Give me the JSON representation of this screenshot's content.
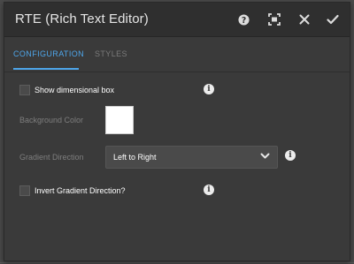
{
  "dialog": {
    "title": "RTE (Rich Text Editor)",
    "toolbar": {
      "help_icon": "help-icon",
      "fullscreen_icon": "fullscreen-icon",
      "close_icon": "close-icon",
      "confirm_icon": "checkmark-icon"
    }
  },
  "tabs": [
    {
      "label": "CONFIGURATION",
      "active": true
    },
    {
      "label": "STYLES",
      "active": false
    }
  ],
  "form": {
    "show_dimensional_box": {
      "label": "Show dimensional box",
      "checked": false
    },
    "background_color": {
      "label": "Background Color",
      "value": "#ffffff"
    },
    "gradient_direction": {
      "label": "Gradient Direction",
      "value": "Left to Right"
    },
    "invert_gradient": {
      "label": "Invert Gradient Direction?",
      "checked": false
    },
    "info_glyph": "i"
  },
  "colors": {
    "accent": "#4ea6ea",
    "dialog_bg": "#3a3a3a",
    "titlebar_bg": "#2f2f2f"
  }
}
